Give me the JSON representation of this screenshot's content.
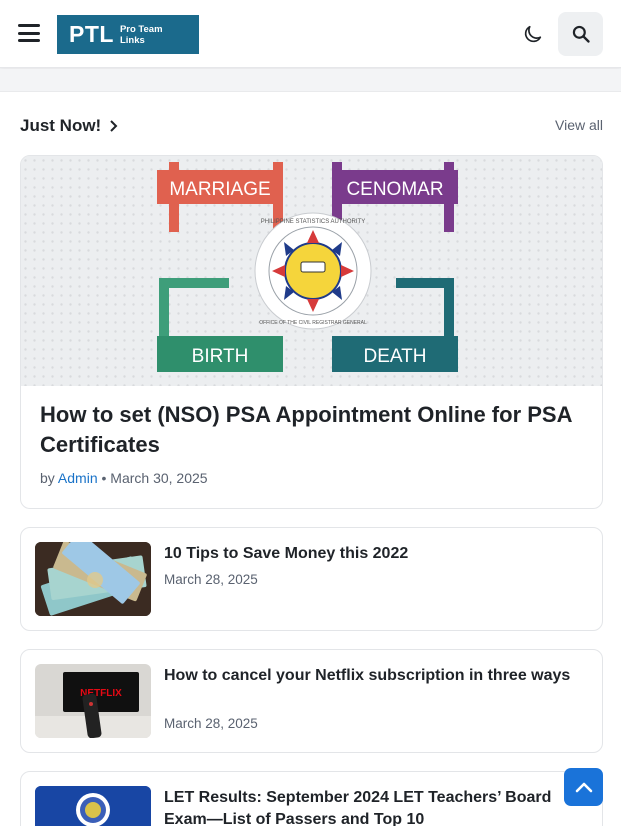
{
  "header": {
    "logo_main": "PTL",
    "logo_sub_line1": "Pro Team",
    "logo_sub_line2": "Links",
    "menu_icon": "hamburger-icon",
    "theme_icon": "moon-icon",
    "search_icon": "search-icon"
  },
  "section": {
    "title": "Just Now!",
    "view_all": "View all"
  },
  "featured": {
    "image_labels": {
      "top_left": "MARRIAGE",
      "top_right": "CENOMAR",
      "bottom_left": "BIRTH",
      "bottom_right": "DEATH"
    },
    "seal_text_top": "PHILIPPINE STATISTICS AUTHORITY",
    "seal_text_bottom": "OFFICE OF THE CIVIL REGISTRAR GENERAL",
    "title": "How to set (NSO) PSA Appointment Online for PSA Certificates",
    "by": "by",
    "author": "Admin",
    "separator": "•",
    "date": "March 30, 2025"
  },
  "posts": [
    {
      "title": "10 Tips to Save Money this 2022",
      "date": "March 28, 2025"
    },
    {
      "title": "How to cancel your Netflix subscription in three ways",
      "date": "March 28, 2025",
      "thumb_text": "NETFLIX"
    },
    {
      "title": "LET Results: September 2024 LET Teachers’ Board Exam—List of Passers and Top 10",
      "date": ""
    }
  ],
  "colors": {
    "brand": "#1b6a8c",
    "link": "#1a73c8",
    "back_to_top": "#1a73d9",
    "marriage": "#e0614f",
    "cenomar": "#7a3b8c",
    "birth": "#3e9e7a",
    "death": "#1f6b75"
  }
}
